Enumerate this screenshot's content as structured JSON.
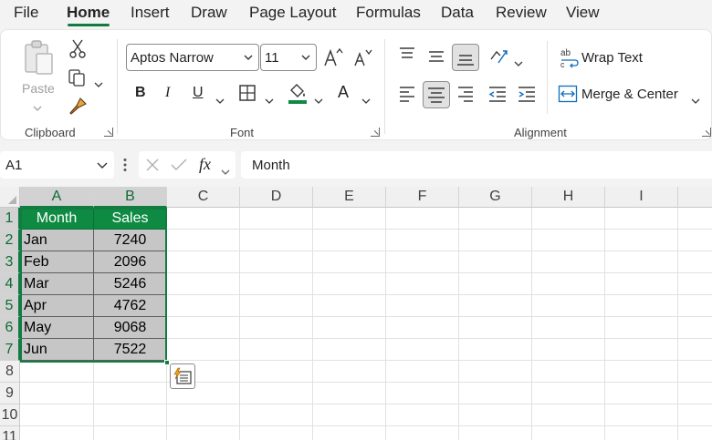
{
  "menu": {
    "tabs": [
      {
        "label": "File"
      },
      {
        "label": "Home"
      },
      {
        "label": "Insert"
      },
      {
        "label": "Draw"
      },
      {
        "label": "Page Layout"
      },
      {
        "label": "Formulas"
      },
      {
        "label": "Data"
      },
      {
        "label": "Review"
      },
      {
        "label": "View"
      }
    ],
    "active": "Home"
  },
  "ribbon": {
    "clipboard": {
      "label": "Clipboard",
      "paste_label": "Paste"
    },
    "font": {
      "label": "Font",
      "font_name": "Aptos Narrow",
      "font_size": "11",
      "bold": "B",
      "italic": "I",
      "underline": "U",
      "font_color_glyph": "A"
    },
    "alignment": {
      "label": "Alignment",
      "wrap_text": "Wrap Text",
      "merge_center": "Merge & Center"
    }
  },
  "formula_bar": {
    "name_box": "A1",
    "fx": "fx",
    "content": "Month"
  },
  "sheet": {
    "columns": [
      "A",
      "B",
      "C",
      "D",
      "E",
      "F",
      "G",
      "H",
      "I"
    ],
    "rows": [
      "1",
      "2",
      "3",
      "4",
      "5",
      "6",
      "7",
      "8",
      "9",
      "10",
      "11"
    ],
    "header": [
      "Month",
      "Sales"
    ],
    "data": [
      [
        "Jan",
        "7240"
      ],
      [
        "Feb",
        "2096"
      ],
      [
        "Mar",
        "5246"
      ],
      [
        "Apr",
        "4762"
      ],
      [
        "May",
        "9068"
      ],
      [
        "Jun",
        "7522"
      ]
    ]
  },
  "colors": {
    "accent": "#117c42",
    "header_fill": "#0e8a43",
    "data_fill": "#c6c6c6"
  }
}
